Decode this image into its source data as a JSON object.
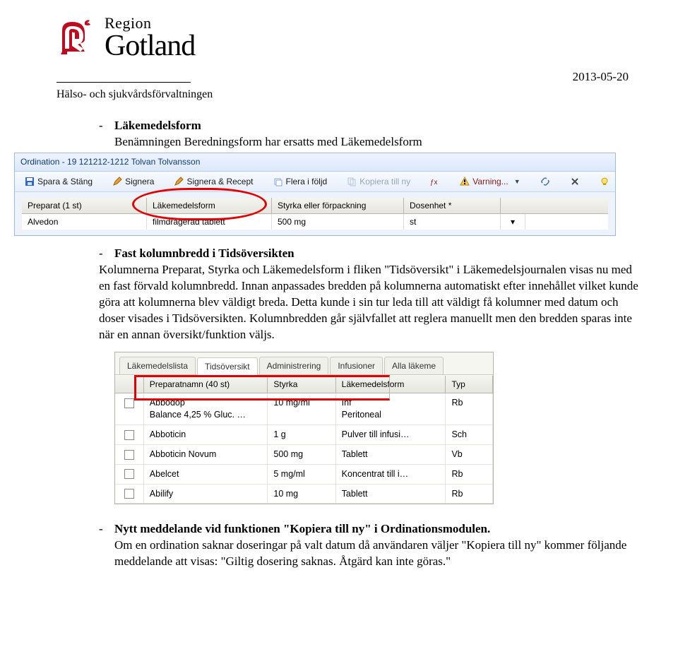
{
  "date": "2013-05-20",
  "org": {
    "region": "Region",
    "name": "Gotland"
  },
  "department": "Hälso- och sjukvårdsförvaltningen",
  "section1": {
    "heading": "Läkemedelsform",
    "sub": "Benämningen Beredningsform har ersatts med Läkemedelsform"
  },
  "shot1": {
    "title": "Ordination - 19 121212-1212 Tolvan Tolvansson",
    "toolbar": {
      "save": "Spara & Stäng",
      "sign": "Signera",
      "sign_recept": "Signera & Recept",
      "flera": "Flera i följd",
      "kopiera": "Kopiera till ny",
      "varning": "Varning..."
    },
    "headers": {
      "c1": "Preparat (1 st)",
      "c2": "Läkemedelsform",
      "c3": "Styrka eller förpackning",
      "c4": "Dosenhet *"
    },
    "values": {
      "c1": "Alvedon",
      "c2": "filmdragerad tablett",
      "c3": "500 mg",
      "c4": "st"
    }
  },
  "section2": {
    "heading": "Fast kolumnbredd i Tidsöversikten",
    "body": "Kolumnerna Preparat, Styrka och Läkemedelsform i fliken \"Tidsöversikt\" i Läkemedelsjournalen visas nu med en fast förvald kolumnbredd. Innan anpassades bredden på kolumnerna automatiskt efter innehållet vilket kunde göra att kolumnerna blev väldigt breda. Detta kunde i sin tur leda till att väldigt få kolumner med datum och doser visades i Tidsöversikten. Kolumnbredden går självfallet att reglera manuellt men den bredden sparas inte när en annan översikt/funktion väljs."
  },
  "shot2": {
    "tabs": [
      "Läkemedelslista",
      "Tidsöversikt",
      "Administrering",
      "Infusioner",
      "Alla läkeme"
    ],
    "active_tab": 1,
    "headers": {
      "name": "Preparatnamn  (40 st)",
      "str": "Styrka",
      "form": "Läkemedelsform",
      "typ": "Typ"
    },
    "rows": [
      {
        "name": "Abbodop\nBalance 4,25 % Gluc. …",
        "str": "10 mg/ml",
        "form": "Inf\nPeritoneal",
        "typ": "Rb"
      },
      {
        "name": "Abboticin",
        "str": "1 g",
        "form": "Pulver till infusi…",
        "typ": "Sch"
      },
      {
        "name": "Abboticin Novum",
        "str": "500 mg",
        "form": "Tablett",
        "typ": "Vb"
      },
      {
        "name": "Abelcet",
        "str": "5 mg/ml",
        "form": "Koncentrat till i…",
        "typ": "Rb"
      },
      {
        "name": "Abilify",
        "str": "10 mg",
        "form": "Tablett",
        "typ": "Rb"
      }
    ]
  },
  "section3": {
    "heading": "Nytt meddelande vid funktionen \"Kopiera till ny\" i Ordinationsmodulen.",
    "body": "Om en ordination saknar doseringar på valt datum då användaren väljer \"Kopiera till ny\" kommer följande meddelande att visas: \"Giltig dosering saknas. Åtgärd kan inte göras.\""
  }
}
